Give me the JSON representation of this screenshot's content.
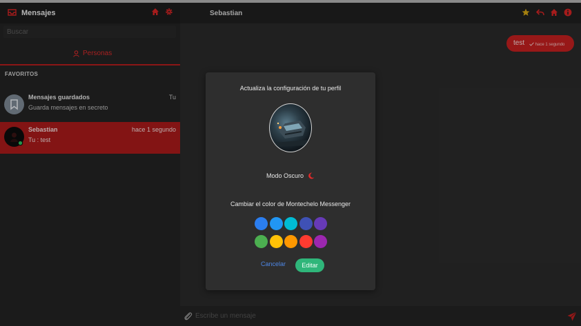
{
  "sidebar": {
    "title": "Mensajes",
    "search_placeholder": "Buscar",
    "tab_label": "Personas",
    "section_label": "FAVORITOS",
    "contacts": [
      {
        "name": "Mensajes guardados",
        "preview": "Guarda mensajes en secreto",
        "time": "Tu"
      },
      {
        "name": "Sebastian",
        "preview": "Tu : test",
        "time": "hace 1 segundo"
      }
    ]
  },
  "chat": {
    "title": "Sebastian",
    "message": {
      "text": "test",
      "meta": "hace 1 segundo"
    },
    "compose_placeholder": "Escribe un mensaje"
  },
  "modal": {
    "title": "Actualiza la configuración de tu perfil",
    "dark_mode_label": "Modo Oscuro",
    "color_label": "Cambiar el color de Montechelo Messenger",
    "colors": [
      "#2b7ef0",
      "#2196f3",
      "#00bcd4",
      "#3f51b5",
      "#673ab7",
      "#4caf50",
      "#ffc107",
      "#ff9800",
      "#ff3b30",
      "#9c27b0"
    ],
    "cancel_label": "Cancelar",
    "edit_label": "Editar"
  },
  "theme": {
    "accent": "#c21f1f",
    "edit_button": "#2fb67a",
    "cancel_link": "#4e87e6",
    "header_icons": "#d42424",
    "star": "#d4a514"
  },
  "icons": {
    "sidebar_header": [
      "inbox-icon",
      "home-icon",
      "gear-icon"
    ],
    "chat_header": [
      "star-icon",
      "reply-icon",
      "home-icon",
      "info-icon"
    ],
    "compose": [
      "paperclip-icon",
      "send-icon"
    ]
  }
}
